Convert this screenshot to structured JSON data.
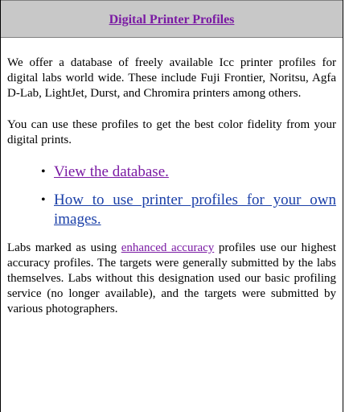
{
  "header": {
    "title": "Digital Printer Profiles"
  },
  "intro": {
    "paragraph1": "We offer a database of freely available Icc printer profiles for digital labs world wide.  These include Fuji Frontier, Noritsu, Agfa D-Lab, LightJet, Durst, and Chromira printers among others.",
    "paragraph2": "You can use these profiles to get the best color fidelity from your digital prints."
  },
  "links": [
    {
      "label": "View the database."
    },
    {
      "label": "How to use printer profiles for your own images."
    }
  ],
  "bottom": {
    "before": "Labs marked as using ",
    "link": "enhanced accuracy",
    "after": " profiles use our highest accuracy profiles. The targets were generally submitted by the labs themselves. Labs without this designation used our basic profiling service (no longer available), and the targets were submitted by various photographers."
  },
  "colors": {
    "header_bg": "#c8c8c8",
    "visited_link": "#7a1aa3",
    "link": "#1a3fa8"
  }
}
